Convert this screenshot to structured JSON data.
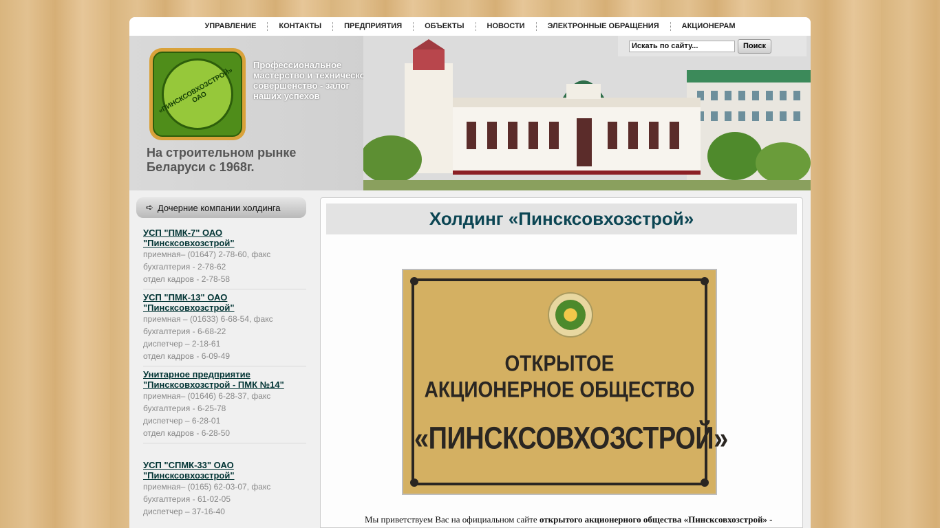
{
  "nav": [
    "УПРАВЛЕНИЕ",
    "КОНТАКТЫ",
    "ПРЕДПРИЯТИЯ",
    "ОБЪЕКТЫ",
    "НОВОСТИ",
    "ЭЛЕКТРОННЫЕ ОБРАЩЕНИЯ",
    "АКЦИОНЕРАМ"
  ],
  "search": {
    "value": "Искать по сайту...",
    "button": "Поиск"
  },
  "header": {
    "logo_text": "«ПИНСКСОВХОЗСТРОЙ» ОАО",
    "slogan": "Профессиональное мастерство и техническое совершенство - залог наших успехов",
    "sub_slogan": "На строительном рынке Беларуси с 1968г."
  },
  "sidebar": {
    "title": "Дочерние компании холдинга",
    "companies": [
      {
        "name": "УСП \"ПМК-7\" ОАО \"Пинсксовхозстрой\"",
        "lines": [
          "приемная– (01647) 2-78-60, факс",
          "бухгалтерия - 2-78-62",
          "отдел кадров - 2-78-58"
        ]
      },
      {
        "name": "УСП \"ПМК-13\" ОАО \"Пинсксовхозстрой\"",
        "lines": [
          "приемная – (01633) 6-68-54, факс",
          "бухгалтерия - 6-68-22",
          "диспетчер – 2-18-61",
          "отдел кадров - 6-09-49"
        ]
      },
      {
        "name": "Унитарное предприятие \"Пинсксовхозстрой - ПМК №14\"",
        "lines": [
          "приемная– (01646) 6-28-37, факс",
          "бухгалтерия - 6-25-78",
          "диспетчер – 6-28-01",
          "отдел кадров - 6-28-50"
        ]
      },
      {
        "name": "УСП \"СПМК-33\" ОАО \"Пинсксовхозстрой\"",
        "lines": [
          "приемная– (0165) 62-03-07, факс",
          "бухгалтерия - 61-02-05",
          "диспетчер – 37-16-40"
        ]
      }
    ]
  },
  "main": {
    "title": "Холдинг «Пинсксовхозстрой»",
    "plaque": {
      "line1": "ОТКРЫТОЕ",
      "line2": "АКЦИОНЕРНОЕ ОБЩЕСТВО",
      "line3": "«ПИНСКСОВХОЗСТРОЙ»"
    },
    "welcome_prefix": "Мы приветствуем Вас на официальном сайте ",
    "welcome_bold": "открытого акционерного общества «Пинсксовхозстрой» -"
  }
}
